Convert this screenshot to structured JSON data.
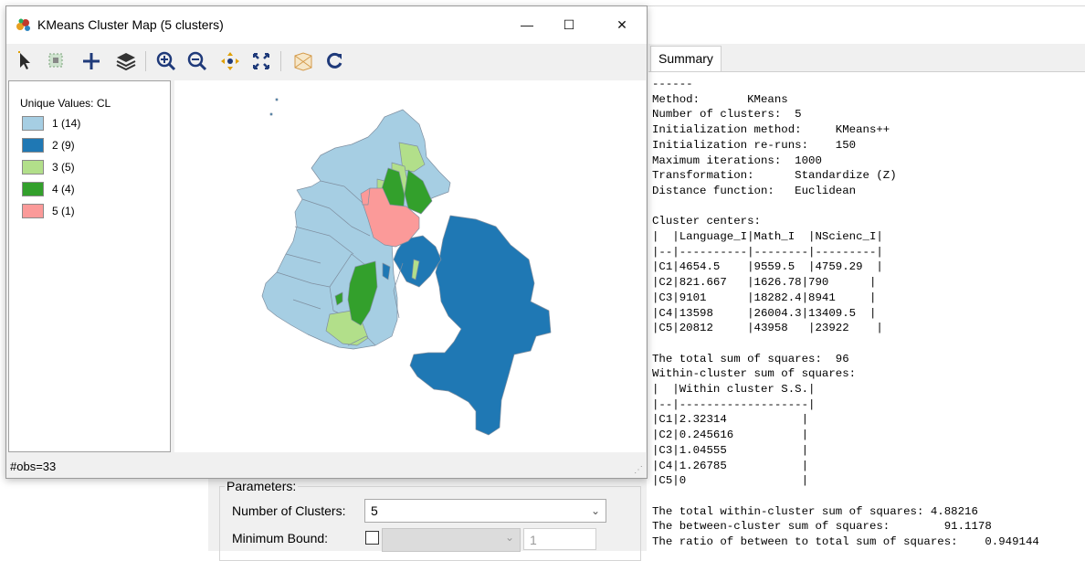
{
  "map_window": {
    "title": "KMeans Cluster Map (5 clusters)",
    "controls": {
      "minimize": "—",
      "maximize": "☐",
      "close": "✕"
    },
    "toolbar_icons": [
      "select-pointer-icon",
      "select-box-icon",
      "add-layer-icon",
      "layers-icon",
      "zoom-in-icon",
      "zoom-out-icon",
      "pan-icon",
      "full-extent-icon",
      "basemap-icon",
      "refresh-icon"
    ],
    "legend": {
      "title": "Unique Values: CL",
      "items": [
        {
          "label": "1 (14)",
          "color": "#a6cee3"
        },
        {
          "label": "2 (9)",
          "color": "#1f78b4"
        },
        {
          "label": "3 (5)",
          "color": "#b2df8a"
        },
        {
          "label": "4 (4)",
          "color": "#33a02c"
        },
        {
          "label": "5 (1)",
          "color": "#fb9a99"
        }
      ]
    },
    "status": "#obs=33"
  },
  "summary": {
    "tab_label": "Summary",
    "text": "------\nMethod:       KMeans\nNumber of clusters:  5\nInitialization method:     KMeans++\nInitialization re-runs:    150\nMaximum iterations:  1000\nTransformation:      Standardize (Z)\nDistance function:   Euclidean\n\nCluster centers:\n|  |Language_I|Math_I  |NScienc_I|\n|--|----------|--------|---------|\n|C1|4654.5    |9559.5  |4759.29  |\n|C2|821.667   |1626.78|790      |\n|C3|9101      |18282.4|8941     |\n|C4|13598     |26004.3|13409.5  |\n|C5|20812     |43958   |23922    |\n\nThe total sum of squares:  96\nWithin-cluster sum of squares:\n|  |Within cluster S.S.|\n|--|-------------------|\n|C1|2.32314           |\n|C2|0.245616          |\n|C3|1.04555           |\n|C4|1.26785           |\n|C5|0                 |\n\nThe total within-cluster sum of squares: 4.88216\nThe between-cluster sum of squares:        91.1178\nThe ratio of between to total sum of squares:    0.949144"
  },
  "parameters": {
    "title": "Parameters:",
    "number_of_clusters_label": "Number of Clusters:",
    "number_of_clusters_value": "5",
    "minimum_bound_label": "Minimum Bound:",
    "minimum_bound_value": "1"
  }
}
